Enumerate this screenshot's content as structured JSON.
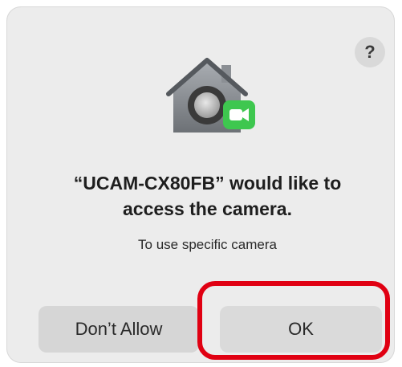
{
  "dialog": {
    "help_label": "?",
    "title_line1": "“UCAM-CX80FB” would like to",
    "title_line2": "access the camera.",
    "subtitle": "To use specific camera",
    "buttons": {
      "dont_allow": "Don’t Allow",
      "ok": "OK"
    },
    "icons": {
      "app_icon": "security-house-camera-icon",
      "facetime_badge": "facetime-video-icon",
      "help": "help-icon"
    },
    "colors": {
      "highlight": "#e00012",
      "facetime_green": "#3ec74f"
    }
  }
}
